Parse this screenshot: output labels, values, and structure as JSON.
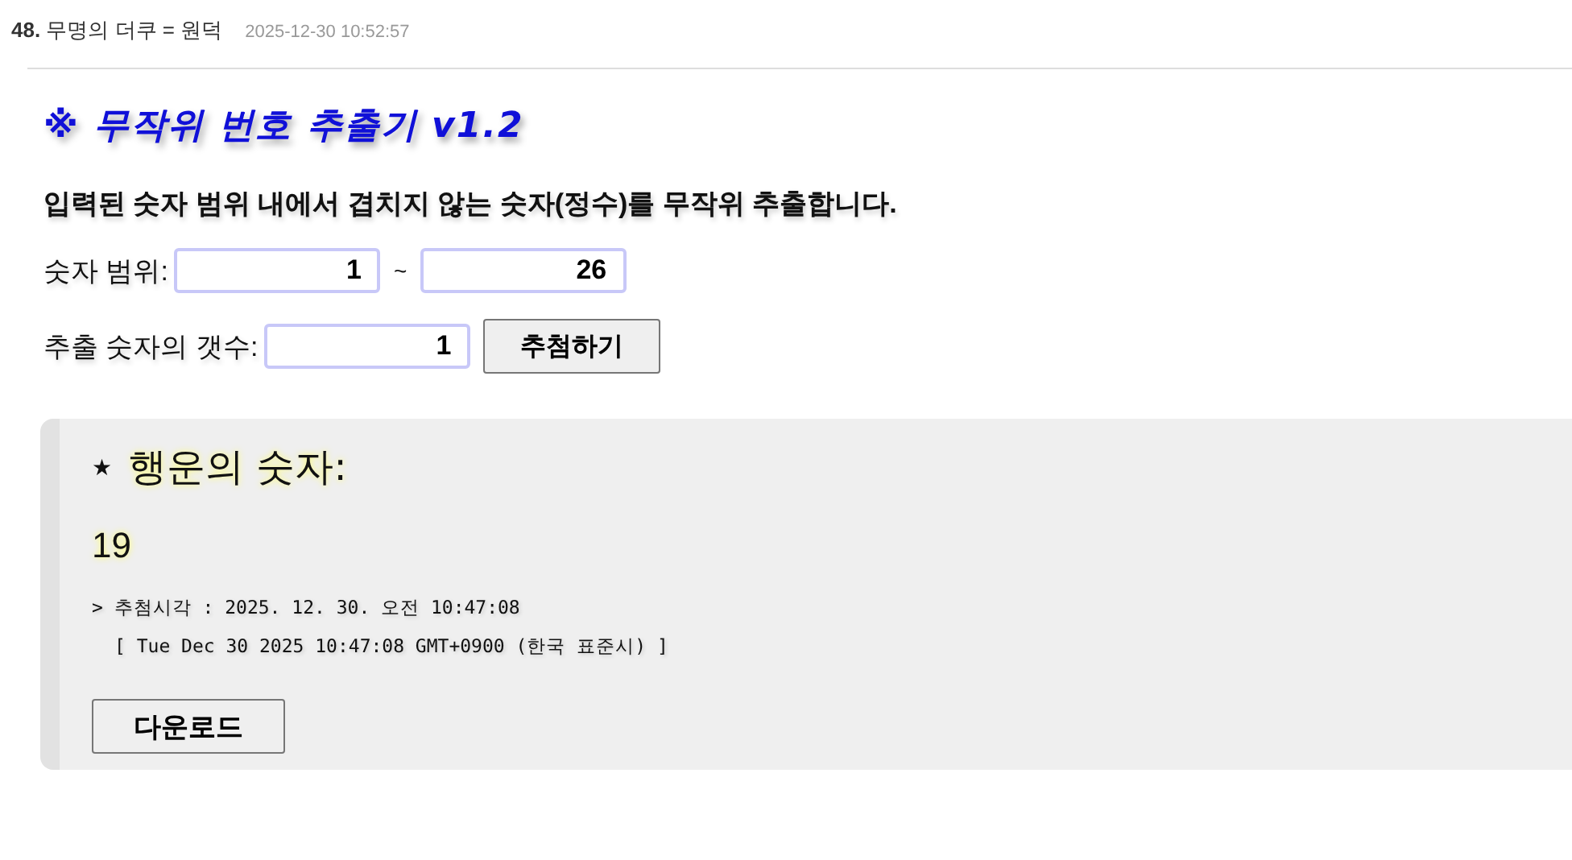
{
  "post": {
    "title": "**48.** 무명의 더쿠 = 원덕",
    "timestamp": "2025-12-30 10:52:57"
  },
  "app_title": "※ 무작위 번호 추출기 v1.2",
  "description": "입력된 숫자 범위 내에서 겹치지 않는 숫자(정수)를 무작위 추출합니다.",
  "range": {
    "label": "숫자 범위:",
    "from": "1",
    "separator": "~",
    "to": "26"
  },
  "count": {
    "label": "추출 숫자의 갯수:",
    "value": "1",
    "button": "추첨하기"
  },
  "result": {
    "star": "★",
    "heading": "행운의 숫자:",
    "numbers": "19",
    "time_line": "> 추첨시각 : 2025. 12. 30. 오전 10:47:08",
    "date_line": "[ Tue Dec 30 2025 10:47:08 GMT+0900 (한국 표준시) ]",
    "download_button": "다운로드"
  }
}
